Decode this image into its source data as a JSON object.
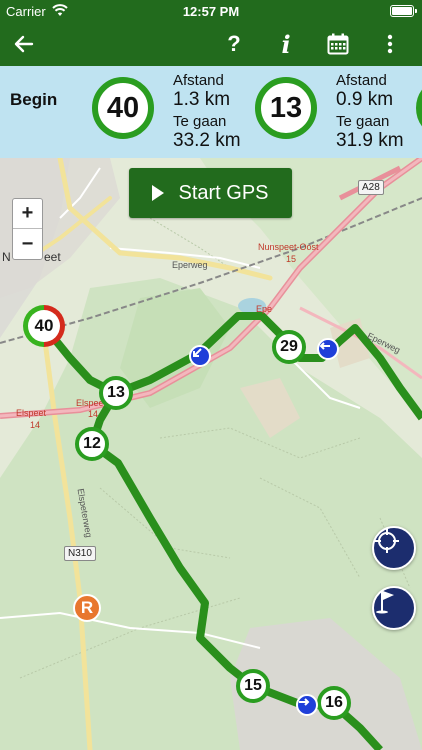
{
  "status_bar": {
    "carrier": "Carrier",
    "time": "12:57 PM"
  },
  "toolbar": {
    "help_label": "?",
    "info_label": "i"
  },
  "info_panel": {
    "begin_label": "Begin",
    "segments": [
      {
        "node": "40",
        "distance_label": "Afstand",
        "distance_value": "1.3 km",
        "remaining_label": "Te gaan",
        "remaining_value": "33.2 km"
      },
      {
        "node": "13",
        "distance_label": "Afstand",
        "distance_value": "0.9 km",
        "remaining_label": "Te gaan",
        "remaining_value": "31.9 km"
      }
    ]
  },
  "map": {
    "start_gps_label": "Start GPS",
    "zoom_in_label": "+",
    "zoom_out_label": "−",
    "markers": {
      "start": "40",
      "m13": "13",
      "m12": "12",
      "m29": "29",
      "m15": "15",
      "m16": "16"
    },
    "poi_label": "R",
    "place_labels": {
      "town": "Nunspeet",
      "town_short": "N",
      "town_tail": "eet",
      "nunspeet_oost": "Nunspeet-Oost",
      "nunspeet_oost_num": "15",
      "eperweg": "Eperweg",
      "elspeet": "Elspeet",
      "elspeet_num": "14",
      "elspeet_left": "Elspeet",
      "elspeet_left_num": "14",
      "elspeeterweg": "Elspeterweg",
      "epe_label": "Epe",
      "road_a28": "A28",
      "road_n310": "N310"
    }
  },
  "colors": {
    "bar_green": "#226b1d",
    "panel_blue": "#bfe3f1",
    "route_green": "#2a9d20",
    "fab_navy": "#1c2d6e",
    "arrow_blue": "#1f3fd9"
  }
}
